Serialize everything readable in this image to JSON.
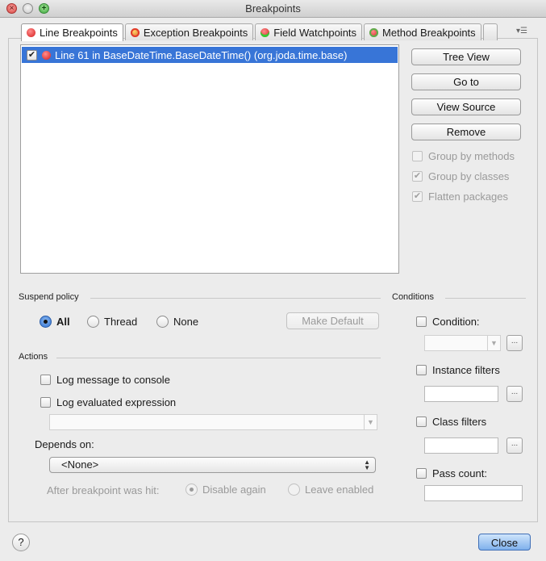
{
  "window": {
    "title": "Breakpoints"
  },
  "tabs": [
    {
      "label": "Line Breakpoints",
      "icon": "line-breakpoint-icon",
      "active": true
    },
    {
      "label": "Exception Breakpoints",
      "icon": "exception-breakpoint-icon"
    },
    {
      "label": "Field Watchpoints",
      "icon": "field-watchpoint-icon"
    },
    {
      "label": "Method Breakpoints",
      "icon": "method-breakpoint-icon"
    }
  ],
  "breakpoints": [
    {
      "label": "Line 61 in BaseDateTime.BaseDateTime() (org.joda.time.base)",
      "checked": true,
      "selected": true
    }
  ],
  "side_buttons": {
    "tree_view": "Tree View",
    "go_to": "Go to",
    "view_source": "View Source",
    "remove": "Remove"
  },
  "view_options": {
    "group_by_methods": "Group by methods",
    "group_by_classes": "Group by classes",
    "flatten_packages": "Flatten packages"
  },
  "suspend_policy": {
    "title": "Suspend policy",
    "options": [
      "All",
      "Thread",
      "None"
    ],
    "selected": "All",
    "make_default": "Make Default"
  },
  "actions": {
    "title": "Actions",
    "log_message": "Log message to console",
    "log_expression": "Log evaluated expression",
    "depends_on_label": "Depends on:",
    "depends_on_value": "<None>",
    "after_hit_label": "After breakpoint was hit:",
    "disable_again": "Disable again",
    "leave_enabled": "Leave enabled"
  },
  "conditions": {
    "title": "Conditions",
    "condition": "Condition:",
    "instance_filters": "Instance filters",
    "class_filters": "Class filters",
    "pass_count": "Pass count:",
    "browse": "..."
  },
  "footer": {
    "help": "?",
    "close": "Close"
  }
}
